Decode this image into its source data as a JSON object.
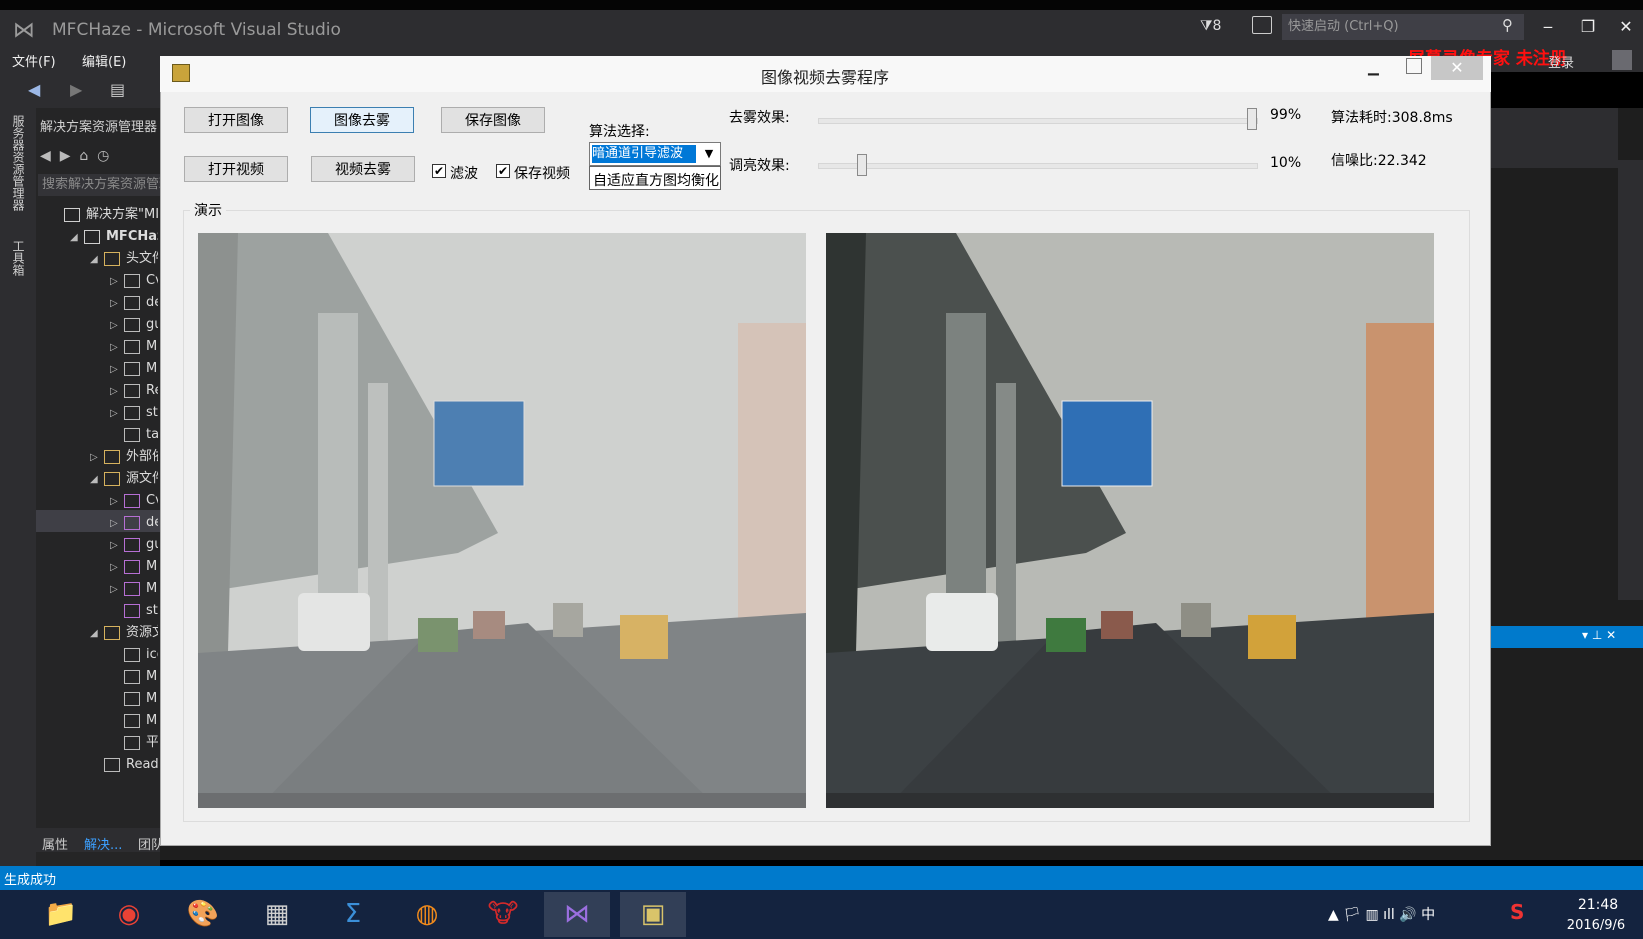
{
  "vs": {
    "title": "MFCHaze - Microsoft Visual Studio",
    "notifications": "8",
    "quick_launch_placeholder": "快速启动 (Ctrl+Q)",
    "menu": [
      "文件(F)",
      "编辑(E)"
    ],
    "login": "登录",
    "watermark": "屏幕录像专家 未注册",
    "status": "生成成功"
  },
  "side_tabs": [
    "服务器资源管理器",
    "工具箱"
  ],
  "solution_explorer": {
    "header": "解决方案资源管理器",
    "search_placeholder": "搜索解决方案资源管理",
    "tree": [
      {
        "indent": 0,
        "arrow": "",
        "label": "解决方案\"MI",
        "bold": false,
        "icon": "solution-icon"
      },
      {
        "indent": 1,
        "arrow": "◢",
        "label": "MFCHaz",
        "bold": true,
        "icon": "project-icon"
      },
      {
        "indent": 2,
        "arrow": "◢",
        "label": "头文件",
        "bold": false,
        "icon": "folder-icon"
      },
      {
        "indent": 3,
        "arrow": "▷",
        "label": "Cv",
        "bold": false,
        "icon": "header-file-icon"
      },
      {
        "indent": 3,
        "arrow": "▷",
        "label": "de",
        "bold": false,
        "icon": "header-file-icon"
      },
      {
        "indent": 3,
        "arrow": "▷",
        "label": "gu",
        "bold": false,
        "icon": "header-file-icon"
      },
      {
        "indent": 3,
        "arrow": "▷",
        "label": "M",
        "bold": false,
        "icon": "header-file-icon"
      },
      {
        "indent": 3,
        "arrow": "▷",
        "label": "M",
        "bold": false,
        "icon": "header-file-icon"
      },
      {
        "indent": 3,
        "arrow": "▷",
        "label": "Re",
        "bold": false,
        "icon": "header-file-icon"
      },
      {
        "indent": 3,
        "arrow": "▷",
        "label": "stc",
        "bold": false,
        "icon": "header-file-icon"
      },
      {
        "indent": 3,
        "arrow": "",
        "label": "tar",
        "bold": false,
        "icon": "header-file-icon"
      },
      {
        "indent": 2,
        "arrow": "▷",
        "label": "外部依",
        "bold": false,
        "icon": "folder-icon"
      },
      {
        "indent": 2,
        "arrow": "◢",
        "label": "源文件",
        "bold": false,
        "icon": "folder-icon"
      },
      {
        "indent": 3,
        "arrow": "▷",
        "label": "Cv",
        "bold": false,
        "icon": "cpp-file-icon"
      },
      {
        "indent": 3,
        "arrow": "▷",
        "label": "de",
        "bold": false,
        "icon": "cpp-file-icon"
      },
      {
        "indent": 3,
        "arrow": "▷",
        "label": "gu",
        "bold": false,
        "icon": "cpp-file-icon"
      },
      {
        "indent": 3,
        "arrow": "▷",
        "label": "M",
        "bold": false,
        "icon": "cpp-file-icon"
      },
      {
        "indent": 3,
        "arrow": "▷",
        "label": "M",
        "bold": false,
        "icon": "cpp-file-icon"
      },
      {
        "indent": 3,
        "arrow": "",
        "label": "stc",
        "bold": false,
        "icon": "cpp-file-icon"
      },
      {
        "indent": 2,
        "arrow": "◢",
        "label": "资源文",
        "bold": false,
        "icon": "folder-icon"
      },
      {
        "indent": 3,
        "arrow": "",
        "label": "ico",
        "bold": false,
        "icon": "image-file-icon"
      },
      {
        "indent": 3,
        "arrow": "",
        "label": "M",
        "bold": false,
        "icon": "image-file-icon"
      },
      {
        "indent": 3,
        "arrow": "",
        "label": "M",
        "bold": false,
        "icon": "resource-file-icon"
      },
      {
        "indent": 3,
        "arrow": "",
        "label": "M",
        "bold": false,
        "icon": "resource-file-icon"
      },
      {
        "indent": 3,
        "arrow": "",
        "label": "平",
        "bold": false,
        "icon": "image-file-icon"
      },
      {
        "indent": 2,
        "arrow": "",
        "label": "Read",
        "bold": false,
        "icon": "text-file-icon"
      }
    ],
    "bottom_tabs": [
      "属性",
      "解决...",
      "团队..."
    ]
  },
  "dialog": {
    "title": "图像视频去雾程序",
    "buttons": {
      "open_image": "打开图像",
      "dehaze_image": "图像去雾",
      "save_image": "保存图像",
      "open_video": "打开视频",
      "dehaze_video": "视频去雾"
    },
    "checkboxes": {
      "filter": {
        "label": "滤波",
        "checked": true
      },
      "save_video": {
        "label": "保存视频",
        "checked": true
      }
    },
    "algorithm": {
      "label": "算法选择:",
      "selected": "暗通道引导滤波",
      "dropdown_option": "自适应直方图均衡化"
    },
    "dehaze_slider": {
      "label": "去雾效果:",
      "value_text": "99%",
      "value": 0.99
    },
    "brightness_slider": {
      "label": "调亮效果:",
      "value_text": "10%",
      "value": 0.1
    },
    "stats": {
      "time": "算法耗时:308.8ms",
      "snr": "信噪比:22.342"
    },
    "group_label": "演示"
  },
  "taskbar": {
    "apps": [
      {
        "name": "file-explorer-icon",
        "glyph": "📁"
      },
      {
        "name": "chrome-icon",
        "glyph": "◉"
      },
      {
        "name": "paint-icon",
        "glyph": "🎨"
      },
      {
        "name": "calculator-icon",
        "glyph": "▦"
      },
      {
        "name": "sigma-app-icon",
        "glyph": "Σ"
      },
      {
        "name": "firefox-icon",
        "glyph": "◍"
      },
      {
        "name": "bull-app-icon",
        "glyph": "🐮"
      },
      {
        "name": "visual-studio-icon",
        "glyph": "⋈"
      },
      {
        "name": "mfchaze-app-icon",
        "glyph": "▣"
      }
    ],
    "tray": "▲  🏳  ▥  ıll  🔊  中",
    "time": "21:48",
    "date": "2016/9/6"
  }
}
